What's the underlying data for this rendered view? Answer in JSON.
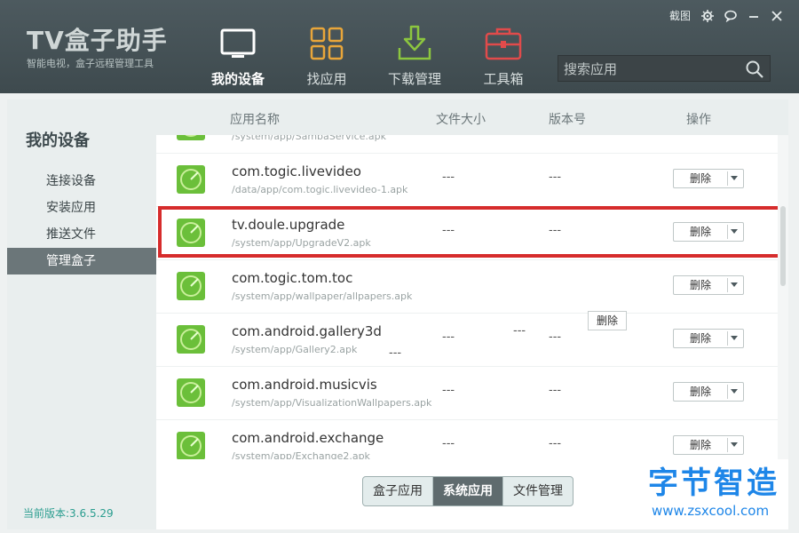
{
  "app": {
    "logo": "TV盒子助手",
    "subtitle": "智能电视，盒子远程管理工具",
    "version_label": "当前版本:3.6.5.29"
  },
  "window": {
    "screenshot_label": "截图"
  },
  "nav": [
    {
      "label": "我的设备",
      "icon": "tv-icon",
      "active": true
    },
    {
      "label": "找应用",
      "icon": "grid-icon"
    },
    {
      "label": "下载管理",
      "icon": "download-icon"
    },
    {
      "label": "工具箱",
      "icon": "toolbox-icon"
    }
  ],
  "search": {
    "placeholder": "搜索应用"
  },
  "sidebar": {
    "title": "我的设备",
    "items": [
      {
        "label": "连接设备"
      },
      {
        "label": "安装应用"
      },
      {
        "label": "推送文件"
      },
      {
        "label": "管理盒子",
        "active": true
      }
    ]
  },
  "table": {
    "headers": {
      "name": "应用名称",
      "size": "文件大小",
      "version": "版本号",
      "action": "操作"
    },
    "delete_label": "删除",
    "rows": [
      {
        "name": "",
        "path": "/system/app/SambaService.apk",
        "size": "",
        "version": ""
      },
      {
        "name": "com.togic.livevideo",
        "path": "/data/app/com.togic.livevideo-1.apk",
        "size": "---",
        "version": "---"
      },
      {
        "name": "tv.doule.upgrade",
        "path": "/system/app/UpgradeV2.apk",
        "size": "---",
        "version": "---"
      },
      {
        "name": "com.togic.tom.toc",
        "path": "/system/app/wallpaper/allpapers.apk",
        "size": "---",
        "version": ""
      },
      {
        "name": "com.android.gallery3d",
        "path": "/system/app/Gallery2.apk",
        "size": "---",
        "version": "---"
      },
      {
        "name": "com.android.musicvis",
        "path": "/system/app/VisualizationWallpapers.apk",
        "size": "---",
        "version": "---"
      },
      {
        "name": "com.android.exchange",
        "path": "/system/app/Exchange2.apk",
        "size": "---",
        "version": "---"
      }
    ],
    "ghost_dash_a": "---",
    "ghost_dash_b": "---"
  },
  "tabs": [
    {
      "label": "盒子应用"
    },
    {
      "label": "系统应用",
      "active": true
    },
    {
      "label": "文件管理"
    }
  ],
  "watermark": {
    "title": "字节智造",
    "url": "www.zsxcool.com"
  },
  "colors": {
    "header": "#4d5a5f",
    "accent": "#2a9d8f",
    "highlight": "#d62c2c",
    "watermark": "#1e86e8"
  }
}
